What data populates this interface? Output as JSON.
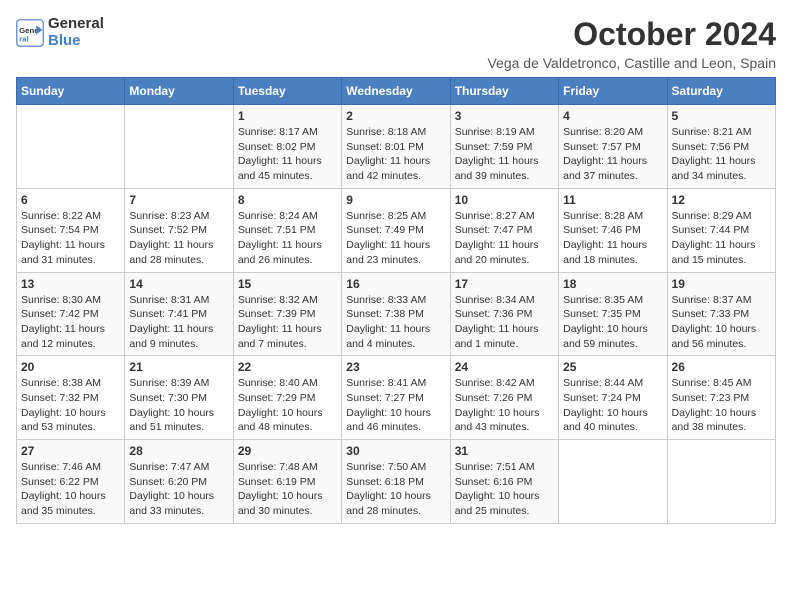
{
  "logo": {
    "line1": "General",
    "line2": "Blue"
  },
  "title": "October 2024",
  "subtitle": "Vega de Valdetronco, Castille and Leon, Spain",
  "days_of_week": [
    "Sunday",
    "Monday",
    "Tuesday",
    "Wednesday",
    "Thursday",
    "Friday",
    "Saturday"
  ],
  "weeks": [
    [
      {
        "day": "",
        "info": ""
      },
      {
        "day": "",
        "info": ""
      },
      {
        "day": "1",
        "info": "Sunrise: 8:17 AM\nSunset: 8:02 PM\nDaylight: 11 hours and 45 minutes."
      },
      {
        "day": "2",
        "info": "Sunrise: 8:18 AM\nSunset: 8:01 PM\nDaylight: 11 hours and 42 minutes."
      },
      {
        "day": "3",
        "info": "Sunrise: 8:19 AM\nSunset: 7:59 PM\nDaylight: 11 hours and 39 minutes."
      },
      {
        "day": "4",
        "info": "Sunrise: 8:20 AM\nSunset: 7:57 PM\nDaylight: 11 hours and 37 minutes."
      },
      {
        "day": "5",
        "info": "Sunrise: 8:21 AM\nSunset: 7:56 PM\nDaylight: 11 hours and 34 minutes."
      }
    ],
    [
      {
        "day": "6",
        "info": "Sunrise: 8:22 AM\nSunset: 7:54 PM\nDaylight: 11 hours and 31 minutes."
      },
      {
        "day": "7",
        "info": "Sunrise: 8:23 AM\nSunset: 7:52 PM\nDaylight: 11 hours and 28 minutes."
      },
      {
        "day": "8",
        "info": "Sunrise: 8:24 AM\nSunset: 7:51 PM\nDaylight: 11 hours and 26 minutes."
      },
      {
        "day": "9",
        "info": "Sunrise: 8:25 AM\nSunset: 7:49 PM\nDaylight: 11 hours and 23 minutes."
      },
      {
        "day": "10",
        "info": "Sunrise: 8:27 AM\nSunset: 7:47 PM\nDaylight: 11 hours and 20 minutes."
      },
      {
        "day": "11",
        "info": "Sunrise: 8:28 AM\nSunset: 7:46 PM\nDaylight: 11 hours and 18 minutes."
      },
      {
        "day": "12",
        "info": "Sunrise: 8:29 AM\nSunset: 7:44 PM\nDaylight: 11 hours and 15 minutes."
      }
    ],
    [
      {
        "day": "13",
        "info": "Sunrise: 8:30 AM\nSunset: 7:42 PM\nDaylight: 11 hours and 12 minutes."
      },
      {
        "day": "14",
        "info": "Sunrise: 8:31 AM\nSunset: 7:41 PM\nDaylight: 11 hours and 9 minutes."
      },
      {
        "day": "15",
        "info": "Sunrise: 8:32 AM\nSunset: 7:39 PM\nDaylight: 11 hours and 7 minutes."
      },
      {
        "day": "16",
        "info": "Sunrise: 8:33 AM\nSunset: 7:38 PM\nDaylight: 11 hours and 4 minutes."
      },
      {
        "day": "17",
        "info": "Sunrise: 8:34 AM\nSunset: 7:36 PM\nDaylight: 11 hours and 1 minute."
      },
      {
        "day": "18",
        "info": "Sunrise: 8:35 AM\nSunset: 7:35 PM\nDaylight: 10 hours and 59 minutes."
      },
      {
        "day": "19",
        "info": "Sunrise: 8:37 AM\nSunset: 7:33 PM\nDaylight: 10 hours and 56 minutes."
      }
    ],
    [
      {
        "day": "20",
        "info": "Sunrise: 8:38 AM\nSunset: 7:32 PM\nDaylight: 10 hours and 53 minutes."
      },
      {
        "day": "21",
        "info": "Sunrise: 8:39 AM\nSunset: 7:30 PM\nDaylight: 10 hours and 51 minutes."
      },
      {
        "day": "22",
        "info": "Sunrise: 8:40 AM\nSunset: 7:29 PM\nDaylight: 10 hours and 48 minutes."
      },
      {
        "day": "23",
        "info": "Sunrise: 8:41 AM\nSunset: 7:27 PM\nDaylight: 10 hours and 46 minutes."
      },
      {
        "day": "24",
        "info": "Sunrise: 8:42 AM\nSunset: 7:26 PM\nDaylight: 10 hours and 43 minutes."
      },
      {
        "day": "25",
        "info": "Sunrise: 8:44 AM\nSunset: 7:24 PM\nDaylight: 10 hours and 40 minutes."
      },
      {
        "day": "26",
        "info": "Sunrise: 8:45 AM\nSunset: 7:23 PM\nDaylight: 10 hours and 38 minutes."
      }
    ],
    [
      {
        "day": "27",
        "info": "Sunrise: 7:46 AM\nSunset: 6:22 PM\nDaylight: 10 hours and 35 minutes."
      },
      {
        "day": "28",
        "info": "Sunrise: 7:47 AM\nSunset: 6:20 PM\nDaylight: 10 hours and 33 minutes."
      },
      {
        "day": "29",
        "info": "Sunrise: 7:48 AM\nSunset: 6:19 PM\nDaylight: 10 hours and 30 minutes."
      },
      {
        "day": "30",
        "info": "Sunrise: 7:50 AM\nSunset: 6:18 PM\nDaylight: 10 hours and 28 minutes."
      },
      {
        "day": "31",
        "info": "Sunrise: 7:51 AM\nSunset: 6:16 PM\nDaylight: 10 hours and 25 minutes."
      },
      {
        "day": "",
        "info": ""
      },
      {
        "day": "",
        "info": ""
      }
    ]
  ]
}
